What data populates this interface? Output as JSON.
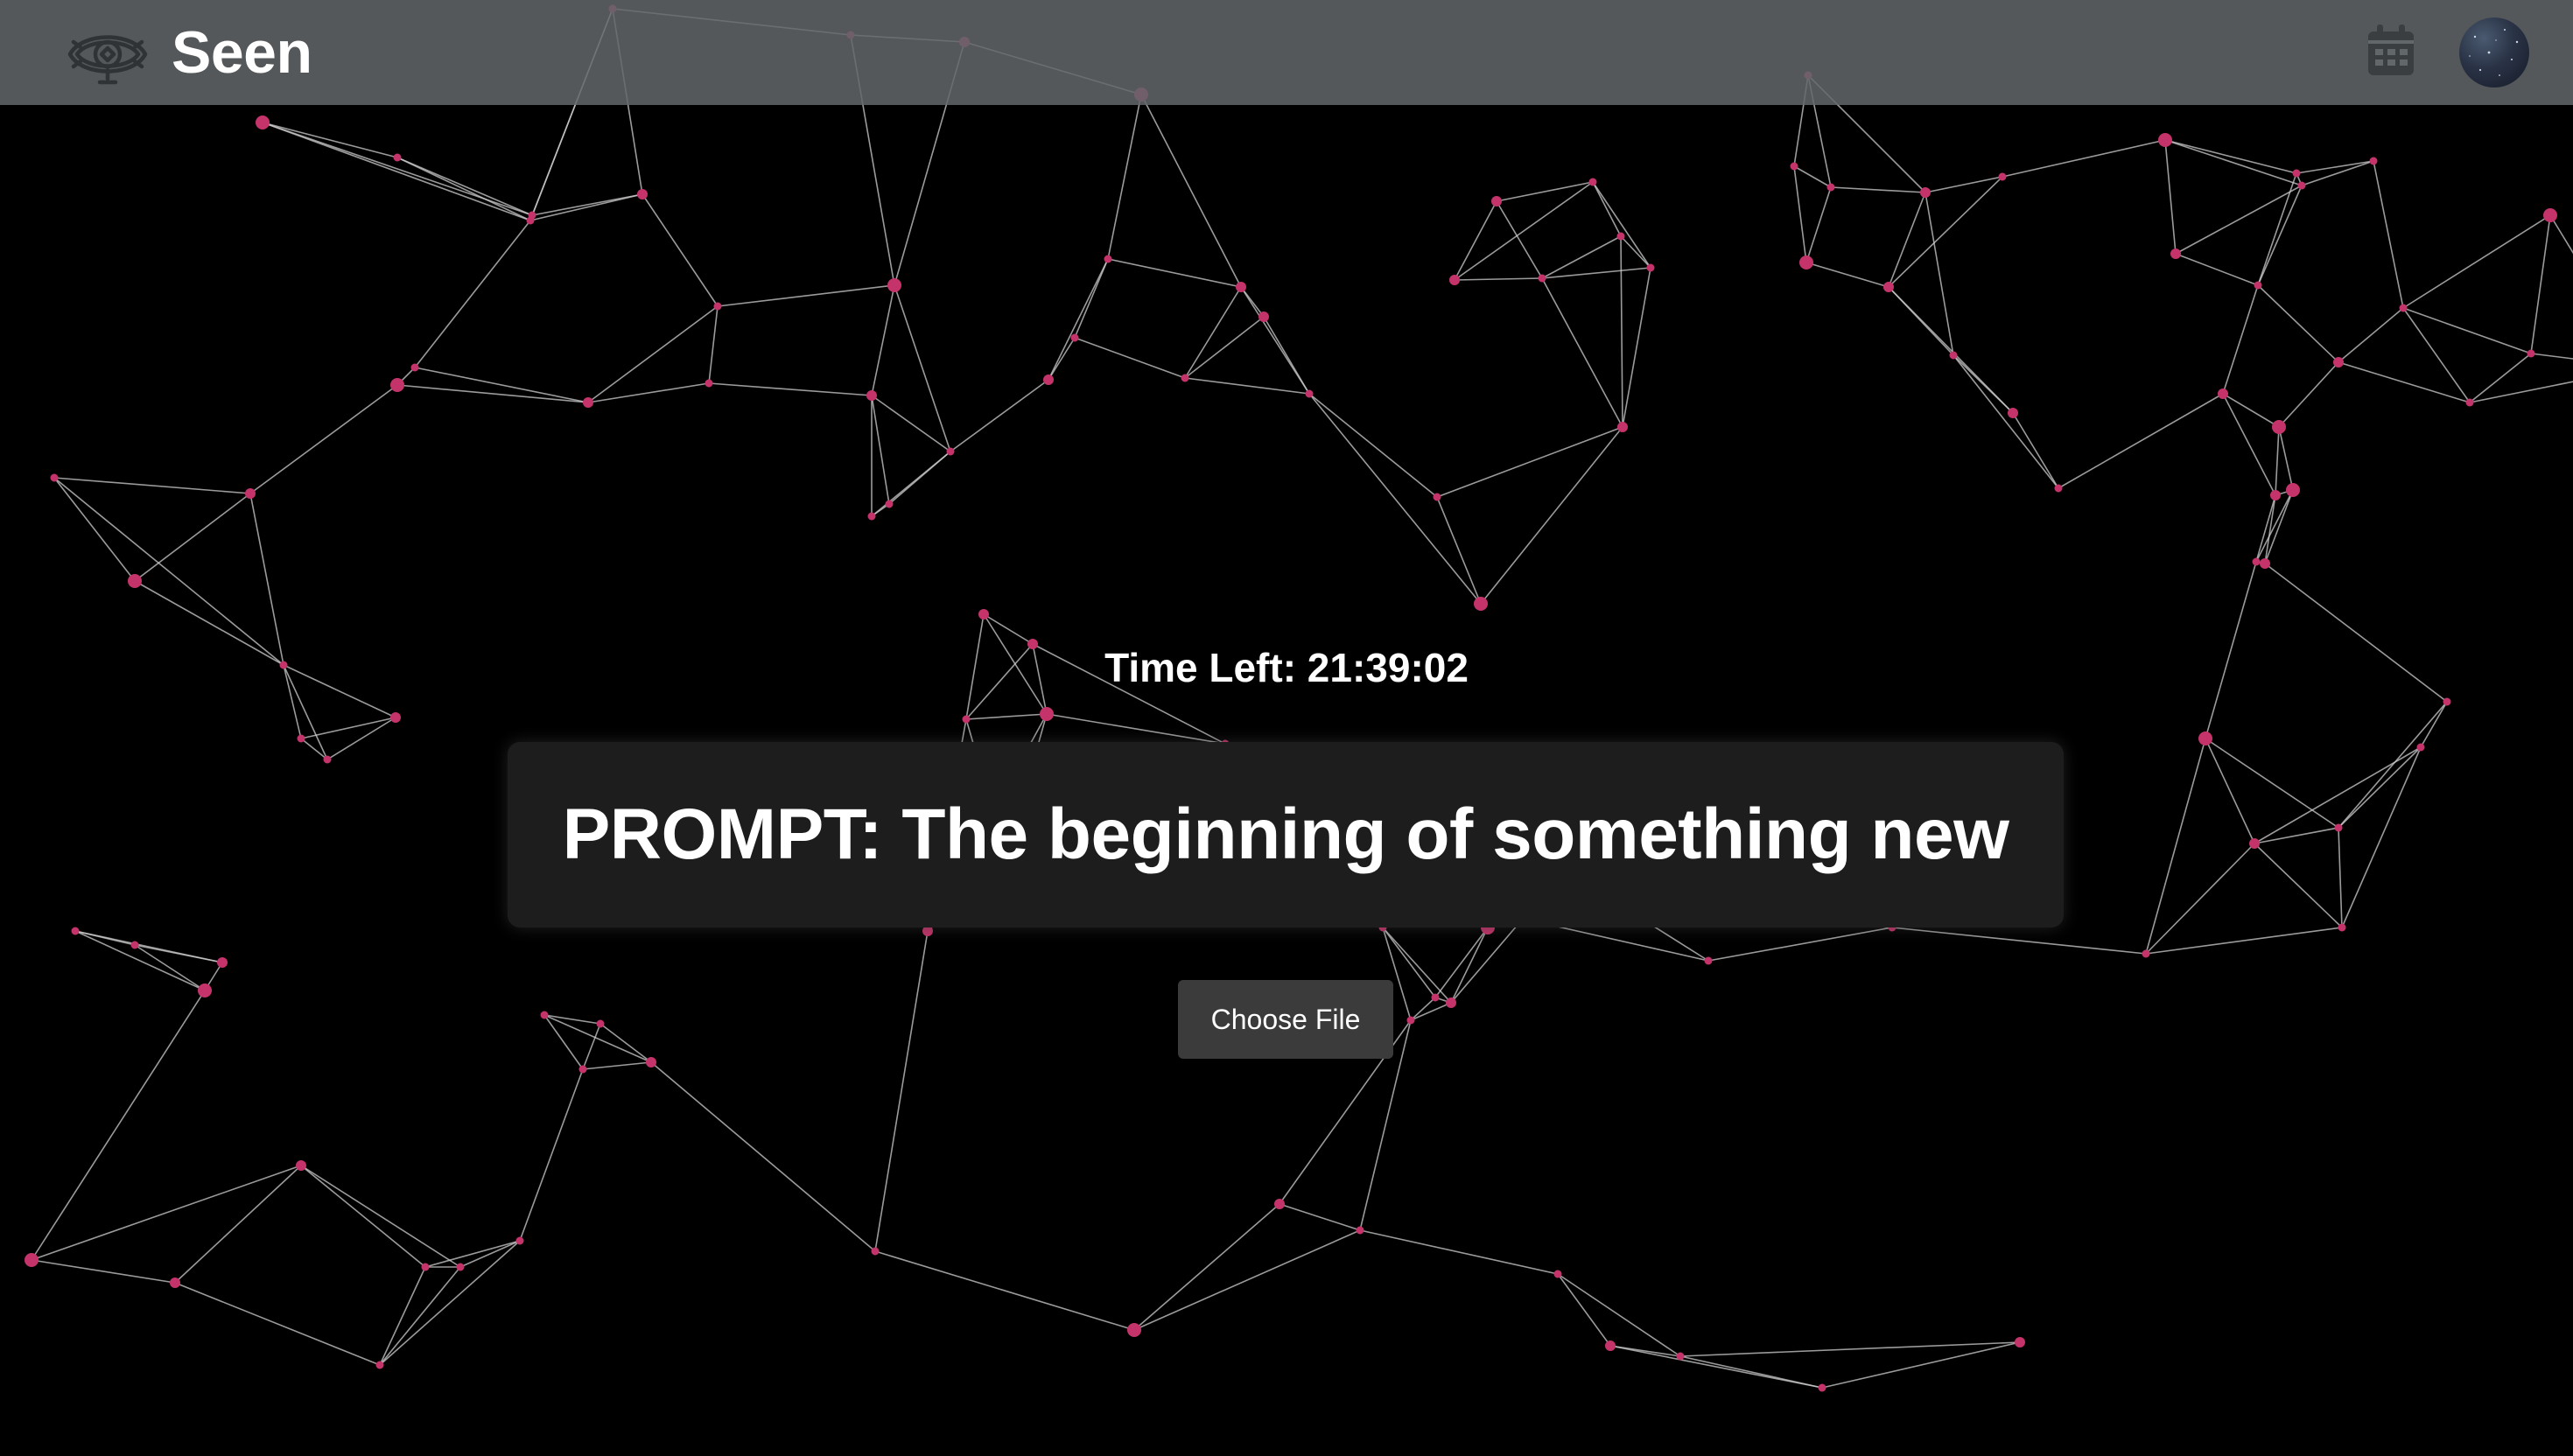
{
  "header": {
    "app_title": "Seen",
    "logo_icon": "eye-logo-icon",
    "calendar_icon": "calendar-icon",
    "avatar_icon": "starry-sky-avatar"
  },
  "main": {
    "timer_text": "Time Left: 21:39:02",
    "prompt_text": "PROMPT: The beginning of something new",
    "upload_button_label": "Choose File"
  },
  "colors": {
    "background": "#000000",
    "header_bg": "#62676a",
    "node": "#c4336a",
    "edge": "#cfcfcf",
    "card_bg": "#1d1d1d",
    "button_bg": "#3b3b3b",
    "text": "#ffffff"
  }
}
